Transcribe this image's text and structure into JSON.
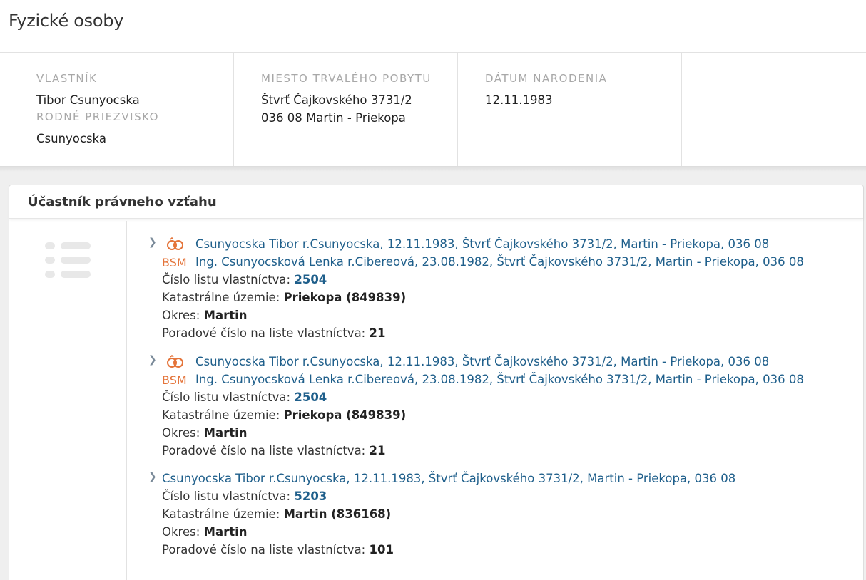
{
  "page_title": "Fyzické osoby",
  "owner": {
    "label": "Vlastník",
    "name": "Tibor Csunyocska",
    "birth_surname_label": "Rodné priezvisko",
    "birth_surname": "Csunyocska"
  },
  "residence": {
    "label": "Miesto trvalého pobytu",
    "line1": "Štvrť Čajkovského 3731/2",
    "line2": "036 08 Martin - Priekopa"
  },
  "birth_date": {
    "label": "Dátum narodenia",
    "value": "12.11.1983"
  },
  "panel": {
    "title": "Účastník právneho vzťahu"
  },
  "labels": {
    "lv": "Číslo listu vlastníctva:",
    "ku": "Katastrálne územie:",
    "okres": "Okres:",
    "poradove": "Poradové číslo na liste vlastníctva:"
  },
  "items": [
    {
      "type": "BSM",
      "badge": "BSM",
      "person1": "Csunyocska Tibor r.Csunyocska, 12.11.1983, Štvrť Čajkovského 3731/2, Martin - Priekopa, 036 08",
      "person2": "Ing. Csunyocsková Lenka r.Cibereová, 23.08.1982, Štvrť Čajkovského 3731/2, Martin - Priekopa, 036 08",
      "lv": "2504",
      "ku": "Priekopa (849839)",
      "okres": "Martin",
      "poradove": "21"
    },
    {
      "type": "BSM",
      "badge": "BSM",
      "person1": "Csunyocska Tibor r.Csunyocska, 12.11.1983, Štvrť Čajkovského 3731/2, Martin - Priekopa, 036 08",
      "person2": "Ing. Csunyocsková Lenka r.Cibereová, 23.08.1982, Štvrť Čajkovského 3731/2, Martin - Priekopa, 036 08",
      "lv": "2504",
      "ku": "Priekopa (849839)",
      "okres": "Martin",
      "poradove": "21"
    },
    {
      "type": "single",
      "person1": "Csunyocska Tibor r.Csunyocska, 12.11.1983, Štvrť Čajkovského 3731/2, Martin - Priekopa, 036 08",
      "lv": "5203",
      "ku": "Martin (836168)",
      "okres": "Martin",
      "poradove": "101"
    }
  ],
  "colors": {
    "link": "#1f5f8b",
    "bsm_accent": "#e4743a",
    "label_gray": "#a8a8a8",
    "band_gray": "#efefef"
  },
  "icons": {
    "expand": "chevron-right-icon",
    "bsm": "wedding-rings-icon",
    "sidebar": "list-icon"
  }
}
